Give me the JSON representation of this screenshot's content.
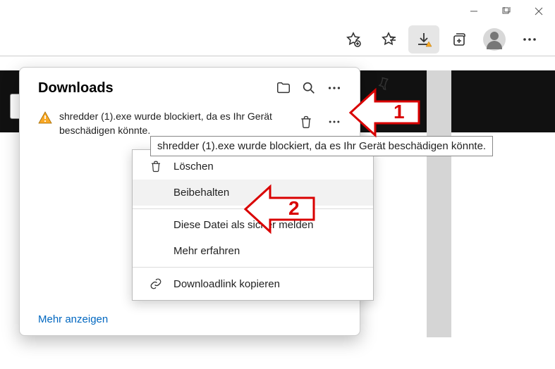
{
  "window": {
    "downloads_title": "Downloads",
    "blocked_text": "shredder (1).exe wurde blockiert, da es Ihr Gerät beschädigen könnte.",
    "blocked_short": "shredder (1).exe wurde blockiert, da es Ihr Gerät beschädigen könnte.",
    "more_link": "Mehr anzeigen"
  },
  "tooltip": "shredder (1).exe wurde blockiert, da es Ihr Gerät beschädigen könnte.",
  "context_menu": {
    "delete": "Löschen",
    "keep": "Beibehalten",
    "report_safe": "Diese Datei als sicher melden",
    "learn_more": "Mehr erfahren",
    "copy_link": "Downloadlink kopieren"
  },
  "annotations": {
    "step1": "1",
    "step2": "2"
  },
  "colors": {
    "accent": "#0067c0",
    "warning_fill": "#f9a825",
    "annotation": "#d90000"
  }
}
